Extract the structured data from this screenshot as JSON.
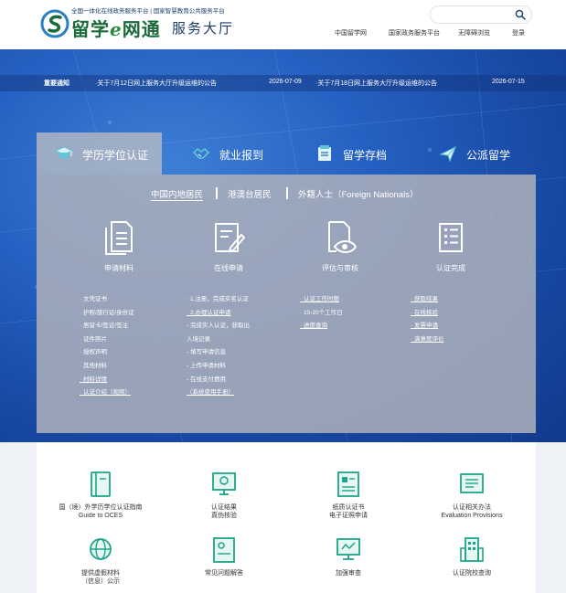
{
  "header": {
    "logo_sub": "全国一体化在线政务服务平台 | 国家智慧教育公共服务平台",
    "logo_main_a": "留学",
    "logo_main_e": "e",
    "logo_main_b": "网通",
    "logo_suffix": "服务大厅",
    "search_placeholder": "",
    "nav": [
      "中国留学网",
      "国家政务服务平台",
      "无障碍浏览",
      "登录"
    ]
  },
  "notice": {
    "label": "重要通知",
    "items": [
      {
        "text": "·关于7月12日网上服务大厅升级运维的公告",
        "date": "2026-07-09"
      },
      {
        "text": "·关于7月18日网上服务大厅升级运维的公告",
        "date": "2026-07-15"
      }
    ]
  },
  "tabs": [
    {
      "label": "学历学位认证",
      "icon": "graduation-cap-icon",
      "active": true
    },
    {
      "label": "就业报到",
      "icon": "handshake-icon",
      "active": false
    },
    {
      "label": "留学存档",
      "icon": "archive-icon",
      "active": false
    },
    {
      "label": "公派留学",
      "icon": "airplane-icon",
      "active": false
    }
  ],
  "subtabs": [
    "中国内地居民",
    "港澳台居民",
    "外籍人士（Foreign Nationals）"
  ],
  "steps": [
    {
      "label": "申请材料",
      "icon": "documents-icon"
    },
    {
      "label": "在线申请",
      "icon": "edit-form-icon"
    },
    {
      "label": "评估与审核",
      "icon": "review-eye-icon"
    },
    {
      "label": "认证完成",
      "icon": "checklist-icon"
    }
  ],
  "columns": [
    [
      "· 文凭证书",
      "· 护照/旅行证/身份证",
      "· 居留卡/签证/签注",
      "· 证件照片",
      "· 授权声明",
      "· 其他材料",
      "· 材料详情",
      "· 认证介绍（视频）"
    ],
    [
      "· 1.注册，完成实名认证",
      "· 2.办理认证申请",
      "   - 完成实人认证，获取出",
      "     入境记录",
      "   - 填写申请信息",
      "   - 上传申请材料",
      "   - 在线支付费用",
      "     （系统使用手册）"
    ],
    [
      "· 认证工作时限",
      "· 10-20个工作日",
      "· 进度查询"
    ],
    [
      "· 获取结果",
      "· 在线核验",
      "· 发票申请",
      "· 满意度评价"
    ]
  ],
  "services": [
    {
      "l1": "国（境）外学历学位认证指南",
      "l2": "Guide to OCES",
      "icon": "guide-book-icon"
    },
    {
      "l1": "认证结果",
      "l2": "真伪核验",
      "icon": "verify-certificate-icon"
    },
    {
      "l1": "纸质认证书",
      "l2": "电子证照申请",
      "icon": "paper-certificate-icon"
    },
    {
      "l1": "认证相关办法",
      "l2": "Evaluation Provisions",
      "icon": "provisions-icon"
    },
    {
      "l1": "提供虚假材料",
      "l2": "（信息）公示",
      "icon": "globe-notice-icon"
    },
    {
      "l1": "常见问题解答",
      "l2": "",
      "icon": "faq-icon"
    },
    {
      "l1": "加强审查",
      "l2": "",
      "icon": "review-monitor-icon"
    },
    {
      "l1": "认证院校查询",
      "l2": "",
      "icon": "school-building-icon"
    }
  ],
  "colors": {
    "brand_green": "#1a6b3a",
    "brand_blue": "#1a3c6b",
    "hero_blue": "#2561c2",
    "icon_teal": "#1ba58a"
  }
}
